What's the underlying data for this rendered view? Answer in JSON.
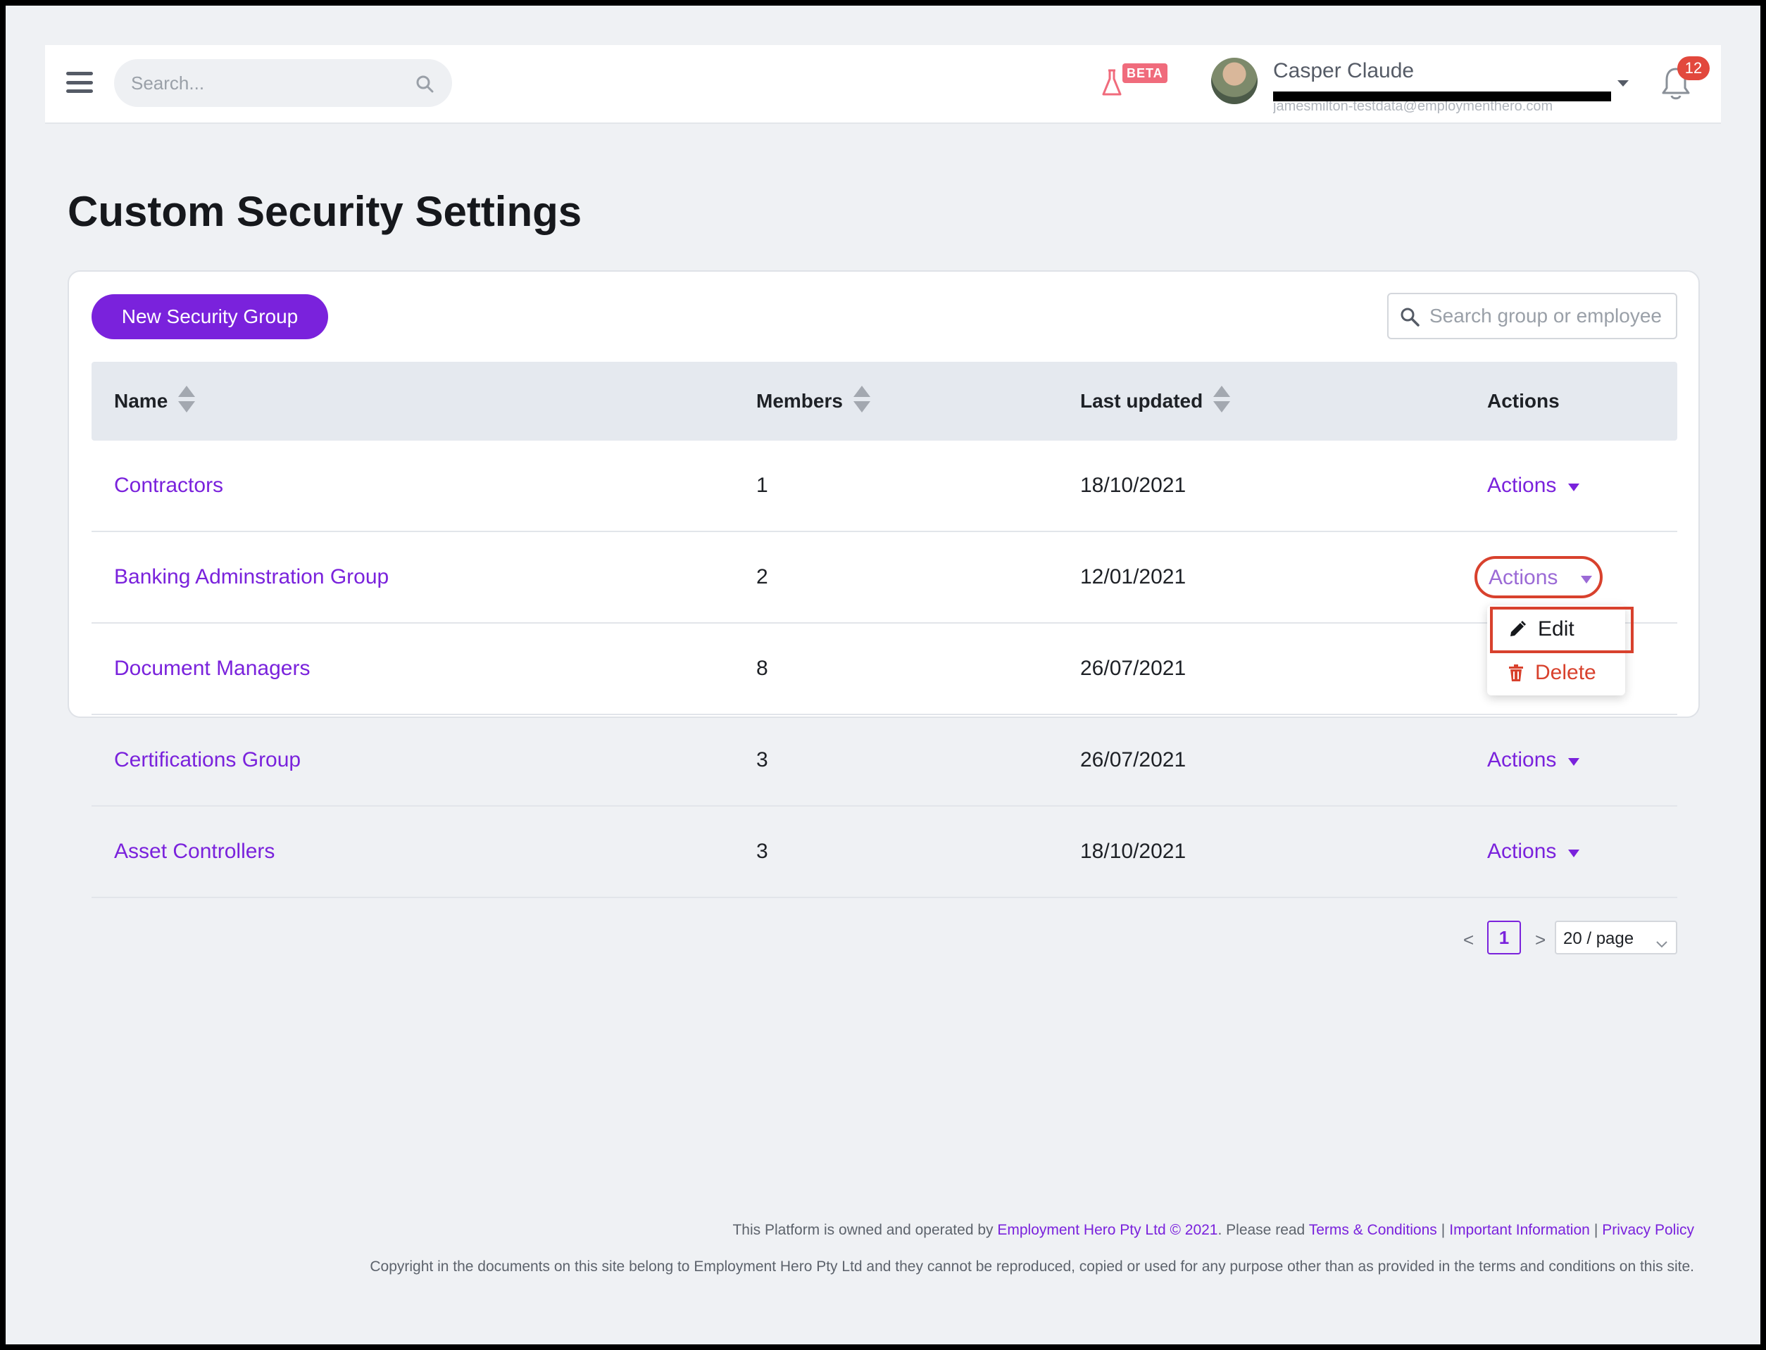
{
  "topbar": {
    "search_placeholder": "Search...",
    "beta_label": "BETA",
    "user_name": "Casper Claude",
    "user_email": "jamesmilton-testdata@employmenthero.com",
    "notification_count": "12"
  },
  "page": {
    "title": "Custom Security Settings"
  },
  "toolbar": {
    "new_group_label": "New Security Group",
    "search_placeholder": "Search group or employee"
  },
  "table": {
    "columns": [
      "Name",
      "Members",
      "Last updated",
      "Actions"
    ],
    "rows": [
      {
        "name": "Contractors",
        "members": "1",
        "last_updated": "18/10/2021",
        "actions": "Actions"
      },
      {
        "name": "Banking Adminstration Group",
        "members": "2",
        "last_updated": "12/01/2021",
        "actions": "Actions"
      },
      {
        "name": "Document Managers",
        "members": "8",
        "last_updated": "26/07/2021",
        "actions": ""
      },
      {
        "name": "Certifications Group",
        "members": "3",
        "last_updated": "26/07/2021",
        "actions": "Actions"
      },
      {
        "name": "Asset Controllers",
        "members": "3",
        "last_updated": "18/10/2021",
        "actions": "Actions"
      }
    ]
  },
  "actions_menu": {
    "edit_label": "Edit",
    "delete_label": "Delete"
  },
  "pagination": {
    "prev": "<",
    "current_page": "1",
    "next": ">",
    "page_size": "20 / page"
  },
  "footer": {
    "line1_prefix": "This Platform is owned and operated by ",
    "company_link": "Employment Hero Pty Ltd © 2021",
    "line1_mid": ". Please read ",
    "terms_link": "Terms & Conditions",
    "important_link": "Important Information",
    "privacy_link": "Privacy Policy",
    "sep": "|",
    "line2": "Copyright in the documents on this site belong to Employment Hero Pty Ltd and they cannot be reproduced, copied or used for any purpose other than as provided in the terms and conditions on this site."
  },
  "colors": {
    "accent": "#7a22dc",
    "danger": "#d8412d",
    "header_bg": "#e5e9ef",
    "page_bg": "#eff1f4"
  }
}
